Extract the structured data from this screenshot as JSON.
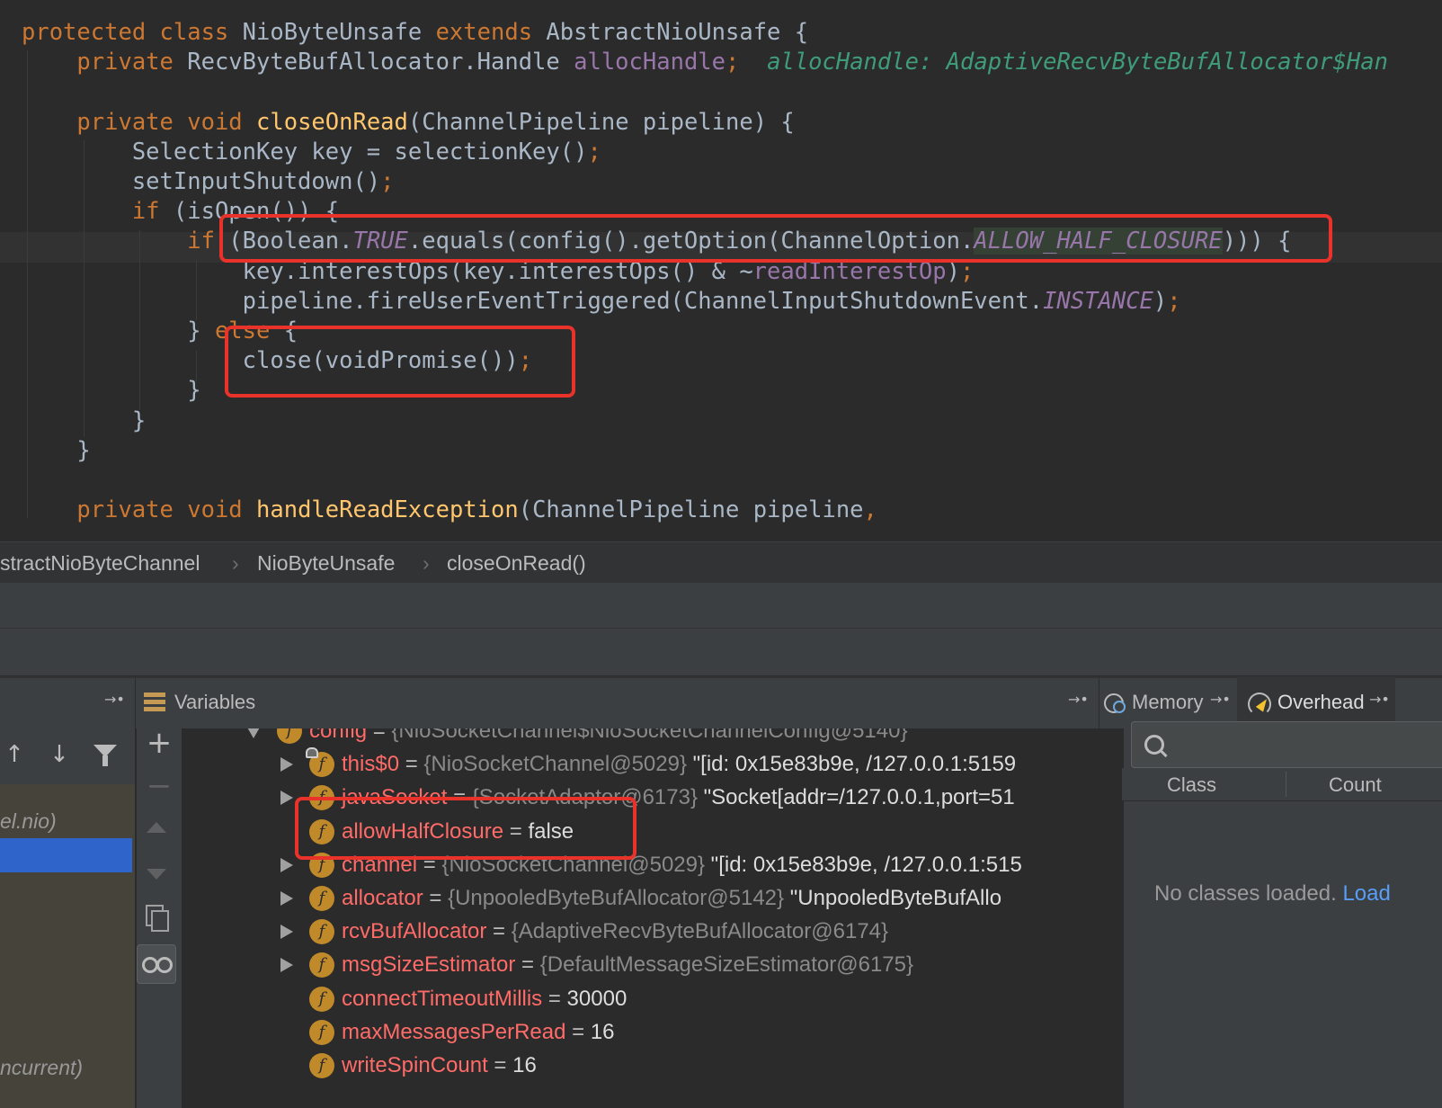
{
  "editor": {
    "lines": [
      [
        {
          "t": "protected class ",
          "c": "kw"
        },
        {
          "t": "NioByteUnsafe "
        },
        {
          "t": "extends ",
          "c": "kw"
        },
        {
          "t": "AbstractNioUnsafe {"
        }
      ],
      [
        {
          "t": "    "
        },
        {
          "t": "private ",
          "c": "kw"
        },
        {
          "t": "RecvByteBufAllocator.Handle "
        },
        {
          "t": "allocHandle",
          "c": "fld"
        },
        {
          "t": ";",
          "c": "pn"
        },
        {
          "t": "  allocHandle: AdaptiveRecvByteBufAllocator$Han",
          "c": "hint"
        }
      ],
      [
        {
          "t": ""
        }
      ],
      [
        {
          "t": "    "
        },
        {
          "t": "private void ",
          "c": "kw"
        },
        {
          "t": "closeOnRead",
          "c": "fn"
        },
        {
          "t": "(ChannelPipeline pipeline) {"
        }
      ],
      [
        {
          "t": "        SelectionKey key = selectionKey()"
        },
        {
          "t": ";",
          "c": "pn"
        }
      ],
      [
        {
          "t": "        setInputShutdown()"
        },
        {
          "t": ";",
          "c": "pn"
        }
      ],
      [
        {
          "t": "        "
        },
        {
          "t": "if ",
          "c": "kw"
        },
        {
          "t": "(isOpen()) {"
        }
      ],
      [
        {
          "t": "            "
        },
        {
          "t": "if ",
          "c": "kw"
        },
        {
          "t": "(Boolean."
        },
        {
          "t": "TRUE",
          "c": "ital"
        },
        {
          "t": ".equals(config().getOption(ChannelOption."
        },
        {
          "t": "ALLOW_HALF_CLOSURE",
          "c": "ital fld-bg"
        },
        {
          "t": "))) {"
        }
      ],
      [
        {
          "t": "                key.interestOps(key.interestOps() & ~"
        },
        {
          "t": "readInterestOp",
          "c": "fld"
        },
        {
          "t": ")"
        },
        {
          "t": ";",
          "c": "pn"
        }
      ],
      [
        {
          "t": "                pipeline.fireUserEventTriggered(ChannelInputShutdownEvent."
        },
        {
          "t": "INSTANCE",
          "c": "ital"
        },
        {
          "t": ")"
        },
        {
          "t": ";",
          "c": "pn"
        }
      ],
      [
        {
          "t": "            } "
        },
        {
          "t": "else ",
          "c": "kw"
        },
        {
          "t": "{"
        }
      ],
      [
        {
          "t": "                close(voidPromise())"
        },
        {
          "t": ";",
          "c": "pn"
        }
      ],
      [
        {
          "t": "            }"
        }
      ],
      [
        {
          "t": "        }"
        }
      ],
      [
        {
          "t": "    }"
        }
      ],
      [
        {
          "t": ""
        }
      ],
      [
        {
          "t": "    "
        },
        {
          "t": "private void ",
          "c": "kw"
        },
        {
          "t": "handleReadException",
          "c": "fn"
        },
        {
          "t": "(ChannelPipeline pipeline"
        },
        {
          "t": ",",
          "c": "pn"
        }
      ]
    ]
  },
  "breadcrumb": {
    "items": [
      "stractNioByteChannel",
      "NioByteUnsafe",
      "closeOnRead()"
    ],
    "separator": "›"
  },
  "panel": {
    "frames_pin": "→•",
    "variables_title": "Variables",
    "variables_pin": "→•",
    "memory_tab": "Memory",
    "memory_pin": "→•",
    "overhead_tab": "Overhead",
    "overhead_pin": "→•"
  },
  "frames": {
    "items": [
      "el.nio)",
      "",
      "ncurrent)"
    ]
  },
  "variables": {
    "rows": [
      {
        "indent": 0,
        "expander": "down",
        "icon": "f",
        "lock": true,
        "name": "config",
        "eq": " = ",
        "type": "{NioSocketChannel$NioSocketChannelConfig@5140}",
        "value": ""
      },
      {
        "indent": 1,
        "expander": "right",
        "icon": "f",
        "lock": true,
        "name": "this$0",
        "eq": " = ",
        "type": "{NioSocketChannel@5029}",
        "value": " \"[id: 0x15e83b9e, /127.0.0.1:5159"
      },
      {
        "indent": 1,
        "expander": "right",
        "icon": "f",
        "lock": false,
        "name": "javaSocket",
        "eq": " = ",
        "type": "{SocketAdaptor@6173}",
        "value": " \"Socket[addr=/127.0.0.1,port=51"
      },
      {
        "indent": 1,
        "expander": "",
        "icon": "f",
        "lock": false,
        "name": "allowHalfClosure",
        "eq": " = ",
        "type": "",
        "value": "false"
      },
      {
        "indent": 1,
        "expander": "right",
        "icon": "f",
        "lock": false,
        "name": "channel",
        "eq": " = ",
        "type": "{NioSocketChannel@5029}",
        "value": " \"[id: 0x15e83b9e, /127.0.0.1:515"
      },
      {
        "indent": 1,
        "expander": "right",
        "icon": "f",
        "lock": false,
        "name": "allocator",
        "eq": " = ",
        "type": "{UnpooledByteBufAllocator@5142}",
        "value": " \"UnpooledByteBufAllo"
      },
      {
        "indent": 1,
        "expander": "right",
        "icon": "f",
        "lock": false,
        "name": "rcvBufAllocator",
        "eq": " = ",
        "type": "{AdaptiveRecvByteBufAllocator@6174}",
        "value": ""
      },
      {
        "indent": 1,
        "expander": "right",
        "icon": "f",
        "lock": false,
        "name": "msgSizeEstimator",
        "eq": " = ",
        "type": "{DefaultMessageSizeEstimator@6175}",
        "value": ""
      },
      {
        "indent": 1,
        "expander": "",
        "icon": "f",
        "lock": false,
        "name": "connectTimeoutMillis",
        "eq": " = ",
        "type": "",
        "value": "30000"
      },
      {
        "indent": 1,
        "expander": "",
        "icon": "f",
        "lock": false,
        "name": "maxMessagesPerRead",
        "eq": " = ",
        "type": "",
        "value": "16"
      },
      {
        "indent": 1,
        "expander": "",
        "icon": "f",
        "lock": false,
        "name": "writeSpinCount",
        "eq": " = ",
        "type": "",
        "value": "16"
      }
    ]
  },
  "memory": {
    "search_placeholder": "",
    "columns": [
      "Class",
      "Count"
    ],
    "empty_text": "No classes loaded. ",
    "load_link": "Load"
  },
  "colors": {
    "highlight_box": "#e8322a",
    "selection": "#2f65ca",
    "keyword": "#cc7832",
    "method": "#ffc66d",
    "field": "#9876aa"
  }
}
